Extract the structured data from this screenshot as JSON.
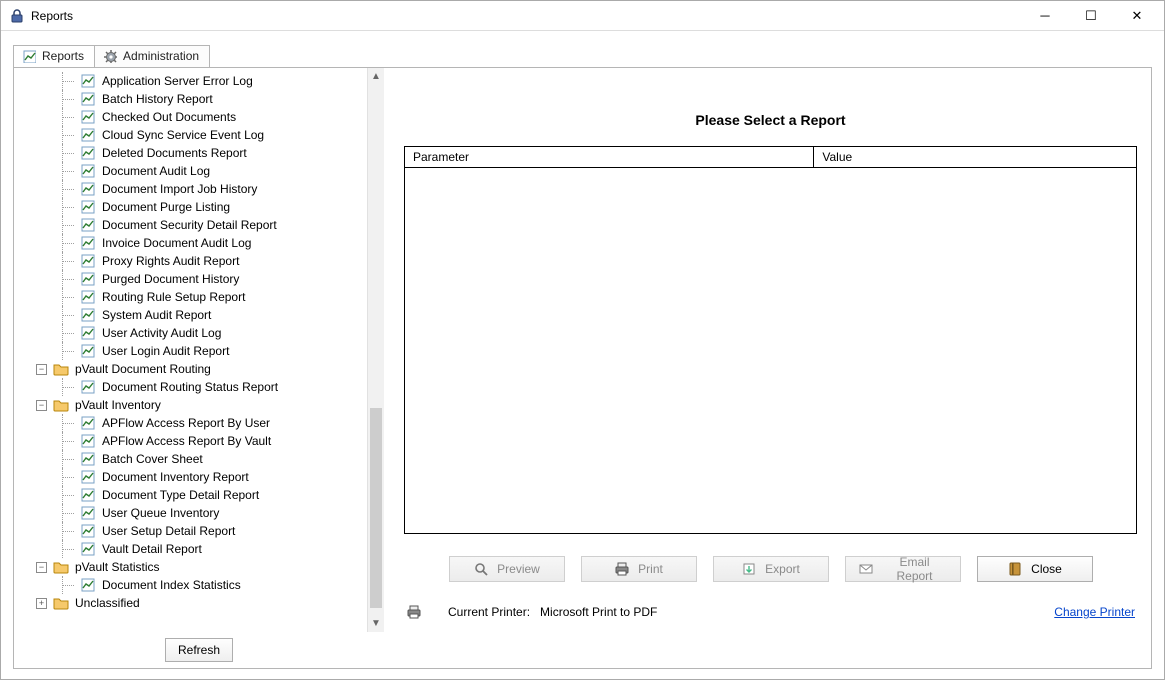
{
  "window": {
    "title": "Reports"
  },
  "tabs": {
    "reports": "Reports",
    "admin": "Administration"
  },
  "tree": {
    "nodes": [
      {
        "type": "report",
        "indent": 2,
        "label": "Application Server Error Log"
      },
      {
        "type": "report",
        "indent": 2,
        "label": "Batch History Report"
      },
      {
        "type": "report",
        "indent": 2,
        "label": "Checked Out Documents"
      },
      {
        "type": "report",
        "indent": 2,
        "label": "Cloud Sync Service Event Log"
      },
      {
        "type": "report",
        "indent": 2,
        "label": "Deleted Documents Report"
      },
      {
        "type": "report",
        "indent": 2,
        "label": "Document Audit Log"
      },
      {
        "type": "report",
        "indent": 2,
        "label": "Document Import Job History"
      },
      {
        "type": "report",
        "indent": 2,
        "label": "Document Purge Listing"
      },
      {
        "type": "report",
        "indent": 2,
        "label": "Document Security Detail Report"
      },
      {
        "type": "report",
        "indent": 2,
        "label": "Invoice Document Audit Log"
      },
      {
        "type": "report",
        "indent": 2,
        "label": "Proxy Rights Audit Report"
      },
      {
        "type": "report",
        "indent": 2,
        "label": "Purged Document History"
      },
      {
        "type": "report",
        "indent": 2,
        "label": "Routing Rule Setup Report"
      },
      {
        "type": "report",
        "indent": 2,
        "label": "System Audit Report"
      },
      {
        "type": "report",
        "indent": 2,
        "label": "User Activity Audit Log"
      },
      {
        "type": "report",
        "indent": 2,
        "label": "User Login Audit Report"
      },
      {
        "type": "folder",
        "indent": 1,
        "label": "pVault Document Routing",
        "expanded": true
      },
      {
        "type": "report",
        "indent": 2,
        "label": "Document Routing Status Report"
      },
      {
        "type": "folder",
        "indent": 1,
        "label": "pVault Inventory",
        "expanded": true
      },
      {
        "type": "report",
        "indent": 2,
        "label": "APFlow Access Report By User"
      },
      {
        "type": "report",
        "indent": 2,
        "label": "APFlow Access Report By Vault"
      },
      {
        "type": "report",
        "indent": 2,
        "label": "Batch Cover Sheet"
      },
      {
        "type": "report",
        "indent": 2,
        "label": "Document Inventory Report"
      },
      {
        "type": "report",
        "indent": 2,
        "label": "Document Type Detail Report"
      },
      {
        "type": "report",
        "indent": 2,
        "label": "User Queue Inventory"
      },
      {
        "type": "report",
        "indent": 2,
        "label": "User Setup Detail Report"
      },
      {
        "type": "report",
        "indent": 2,
        "label": "Vault Detail Report"
      },
      {
        "type": "folder",
        "indent": 1,
        "label": "pVault Statistics",
        "expanded": true
      },
      {
        "type": "report",
        "indent": 2,
        "label": "Document Index Statistics"
      },
      {
        "type": "folder",
        "indent": 1,
        "label": "Unclassified",
        "expanded": false
      }
    ]
  },
  "buttons": {
    "refresh": "Refresh",
    "preview": "Preview",
    "print": "Print",
    "export": "Export",
    "email": "Email Report",
    "close": "Close"
  },
  "right": {
    "prompt": "Please Select a Report",
    "columns": {
      "parameter": "Parameter",
      "value": "Value"
    }
  },
  "status": {
    "printer_label": "Current Printer:",
    "printer_name": "Microsoft Print to PDF",
    "change_link": "Change Printer"
  }
}
